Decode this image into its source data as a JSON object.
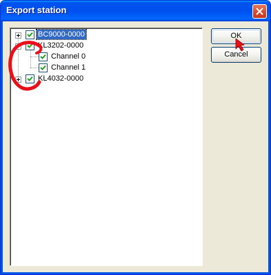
{
  "window": {
    "title": "Export station",
    "close_icon": "close-icon"
  },
  "tree": {
    "nodes": [
      {
        "label": "BC9000-0000",
        "checked": true,
        "expander": "+",
        "selected": true,
        "depth": 0
      },
      {
        "label": "KL3202-0000",
        "checked": true,
        "expander": "-",
        "selected": false,
        "depth": 0
      },
      {
        "label": "Channel 0",
        "checked": true,
        "expander": "",
        "selected": false,
        "depth": 1
      },
      {
        "label": "Channel 1",
        "checked": true,
        "expander": "",
        "selected": false,
        "depth": 1
      },
      {
        "label": "KL4032-0000",
        "checked": true,
        "expander": "+",
        "selected": false,
        "depth": 0
      }
    ]
  },
  "buttons": {
    "ok_label": "OK",
    "cancel_label": "Cancel"
  },
  "colors": {
    "titlebar": "#0054e3",
    "selection": "#316ac5",
    "annotation": "#e8101a"
  }
}
